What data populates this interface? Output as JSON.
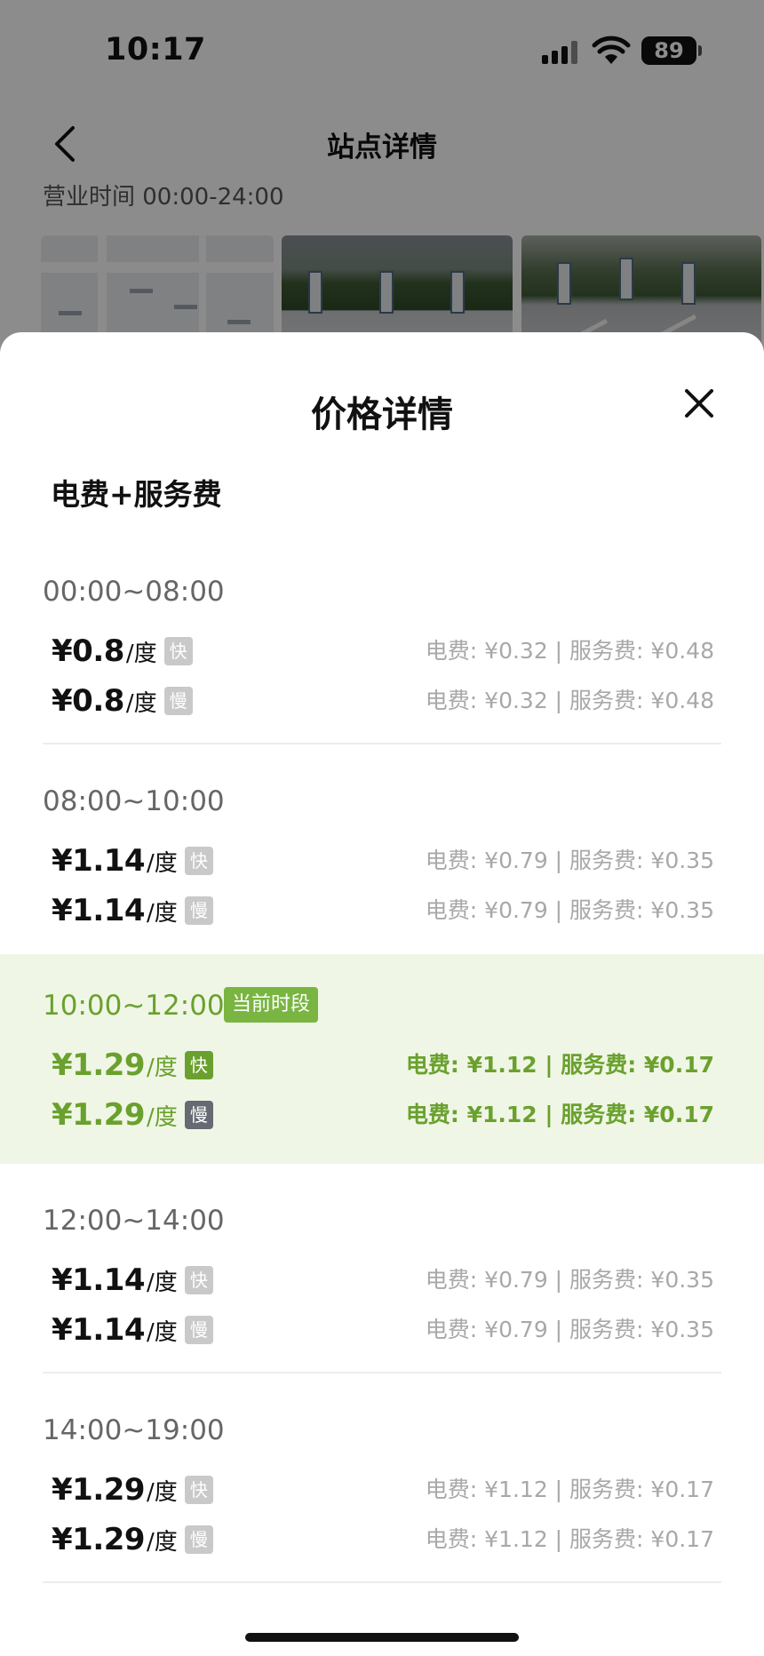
{
  "status_bar": {
    "time": "10:17",
    "battery": "89"
  },
  "background_page": {
    "title": "站点详情",
    "hours": "营业时间 00:00-24:00",
    "photos": [
      "map-thumbnail",
      "station-photo",
      "station-photo"
    ]
  },
  "sheet": {
    "title": "价格详情",
    "section_title": "电费+服务费",
    "current_badge": "当前时段",
    "unit": "/度",
    "tag_fast": "快",
    "tag_slow": "慢",
    "periods": [
      {
        "range": "00:00~08:00",
        "current": false,
        "rows": [
          {
            "price": "¥0.8",
            "breakdown": "电费: ¥0.32 | 服务费: ¥0.48"
          },
          {
            "price": "¥0.8",
            "breakdown": "电费: ¥0.32 | 服务费: ¥0.48"
          }
        ]
      },
      {
        "range": "08:00~10:00",
        "current": false,
        "rows": [
          {
            "price": "¥1.14",
            "breakdown": "电费: ¥0.79 | 服务费: ¥0.35"
          },
          {
            "price": "¥1.14",
            "breakdown": "电费: ¥0.79 | 服务费: ¥0.35"
          }
        ]
      },
      {
        "range": "10:00~12:00",
        "current": true,
        "rows": [
          {
            "price": "¥1.29",
            "breakdown": "电费: ¥1.12 | 服务费: ¥0.17"
          },
          {
            "price": "¥1.29",
            "breakdown": "电费: ¥1.12 | 服务费: ¥0.17"
          }
        ]
      },
      {
        "range": "12:00~14:00",
        "current": false,
        "rows": [
          {
            "price": "¥1.14",
            "breakdown": "电费: ¥0.79 | 服务费: ¥0.35"
          },
          {
            "price": "¥1.14",
            "breakdown": "电费: ¥0.79 | 服务费: ¥0.35"
          }
        ]
      },
      {
        "range": "14:00~19:00",
        "current": false,
        "rows": [
          {
            "price": "¥1.29",
            "breakdown": "电费: ¥1.12 | 服务费: ¥0.17"
          },
          {
            "price": "¥1.29",
            "breakdown": "电费: ¥1.12 | 服务费: ¥0.17"
          }
        ]
      }
    ]
  },
  "colors": {
    "accent_green": "#6aa12e",
    "badge_green": "#7ab542",
    "current_bg": "#f0f6e5",
    "muted_text": "#a8a8a8"
  }
}
